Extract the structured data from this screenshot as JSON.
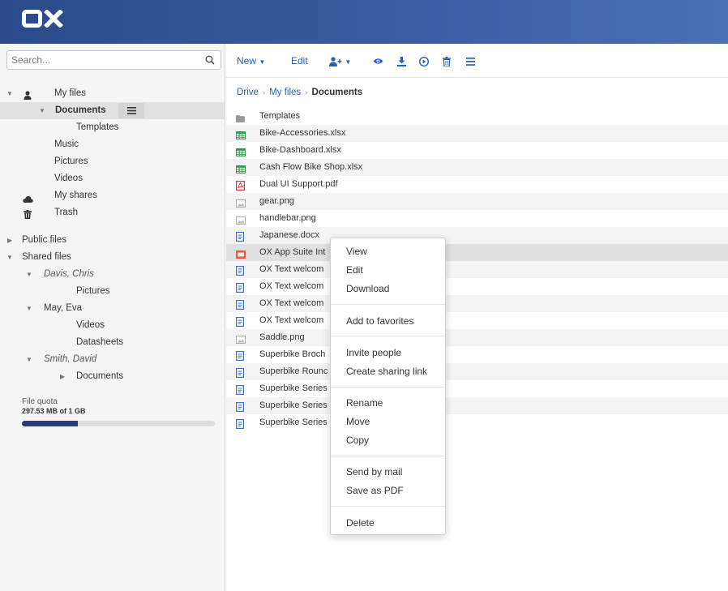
{
  "app": {
    "logo_text": "OX",
    "colors": {
      "header_start": "#2a4a8a",
      "header_end": "#4a70b6",
      "link": "#2b5fb5",
      "quota_fill": "#283e7a"
    }
  },
  "search": {
    "placeholder": "Search...",
    "icon": "search-icon"
  },
  "sidebar": {
    "my_files": "My files",
    "documents": "Documents",
    "templates": "Templates",
    "music": "Music",
    "pictures": "Pictures",
    "videos": "Videos",
    "my_shares": "My shares",
    "trash": "Trash",
    "public_files": "Public files",
    "shared_files": "Shared files",
    "davis": "Davis, Chris",
    "davis_pictures": "Pictures",
    "may": "May, Eva",
    "may_videos": "Videos",
    "may_datasheets": "Datasheets",
    "smith": "Smith, David",
    "smith_documents": "Documents",
    "quota_label": "File quota",
    "quota_value": "297.53 MB of 1 GB",
    "quota_fraction": 0.29
  },
  "toolbar": {
    "new_label": "New",
    "edit_label": "Edit",
    "icons": [
      "share-icon",
      "view-icon",
      "download-icon",
      "present-icon",
      "trash-icon",
      "more-icon"
    ]
  },
  "breadcrumb": {
    "drive": "Drive",
    "my_files": "My files",
    "current": "Documents",
    "separator": "›"
  },
  "files": [
    {
      "name": "Templates",
      "type": "folder"
    },
    {
      "name": "Bike-Accessories.xlsx",
      "type": "spreadsheet"
    },
    {
      "name": "Bike-Dashboard.xlsx",
      "type": "spreadsheet"
    },
    {
      "name": "Cash Flow Bike Shop.xlsx",
      "type": "spreadsheet"
    },
    {
      "name": "Dual UI Support.pdf",
      "type": "pdf"
    },
    {
      "name": "gear.png",
      "type": "image"
    },
    {
      "name": "handlebar.png",
      "type": "image"
    },
    {
      "name": "Japanese.docx",
      "type": "document"
    },
    {
      "name": "OX App Suite Int",
      "type": "presentation"
    },
    {
      "name": "OX Text welcom",
      "type": "document"
    },
    {
      "name": "OX Text welcom",
      "type": "document"
    },
    {
      "name": "OX Text welcom",
      "type": "document"
    },
    {
      "name": "OX Text welcom",
      "type": "document"
    },
    {
      "name": "Saddle.png",
      "type": "image"
    },
    {
      "name": "Superbike Broch",
      "type": "document"
    },
    {
      "name": "Superbike Rounc",
      "type": "document"
    },
    {
      "name": "Superbike Series",
      "type": "document"
    },
    {
      "name": "Superbike Series",
      "type": "document"
    },
    {
      "name": "Superbike Series",
      "type": "document"
    }
  ],
  "context_menu": {
    "view": "View",
    "edit": "Edit",
    "download": "Download",
    "add_to_favorites": "Add to favorites",
    "invite_people": "Invite people",
    "create_sharing_link": "Create sharing link",
    "rename": "Rename",
    "move": "Move",
    "copy": "Copy",
    "send_by_mail": "Send by mail",
    "save_as_pdf": "Save as PDF",
    "delete": "Delete"
  }
}
